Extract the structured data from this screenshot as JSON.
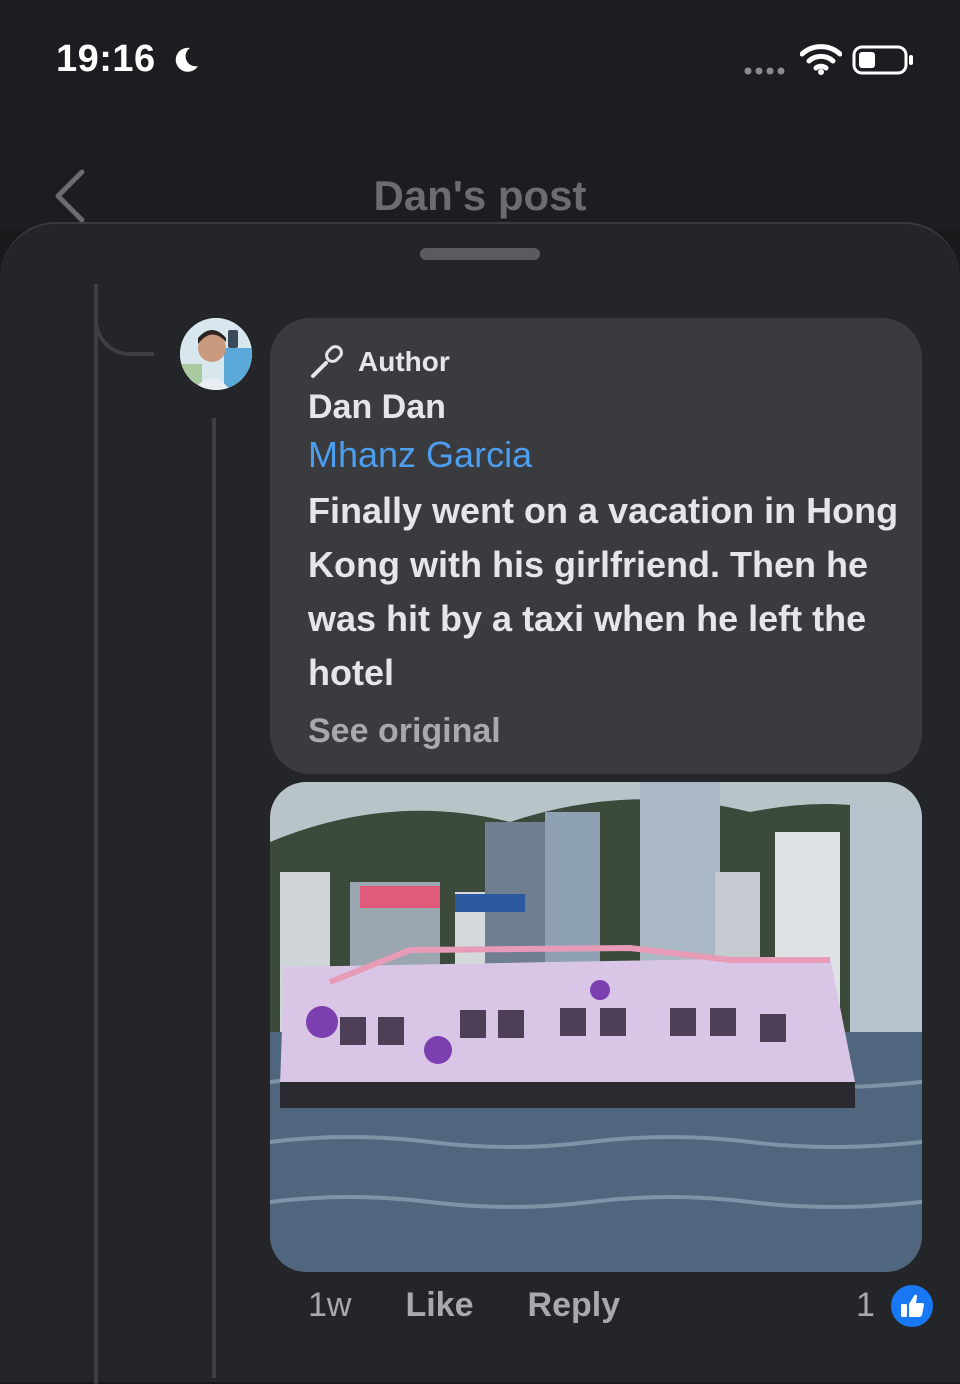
{
  "status": {
    "time": "19:16"
  },
  "nav": {
    "title": "Dan's post"
  },
  "comment": {
    "badge": "Author",
    "commenter": "Dan Dan",
    "tagged": "Mhanz Garcia",
    "text": "Finally went on a vacation in Hong Kong with his girlfriend. Then he was hit by a taxi when he left the hotel",
    "see_original": "See original"
  },
  "actions": {
    "time_ago": "1w",
    "like": "Like",
    "reply": "Reply",
    "reaction_count": "1"
  },
  "colors": {
    "accent_link": "#4e9ef0",
    "like_blue": "#1877f2",
    "bubble": "#3a3b3e",
    "sheet": "#242528"
  }
}
